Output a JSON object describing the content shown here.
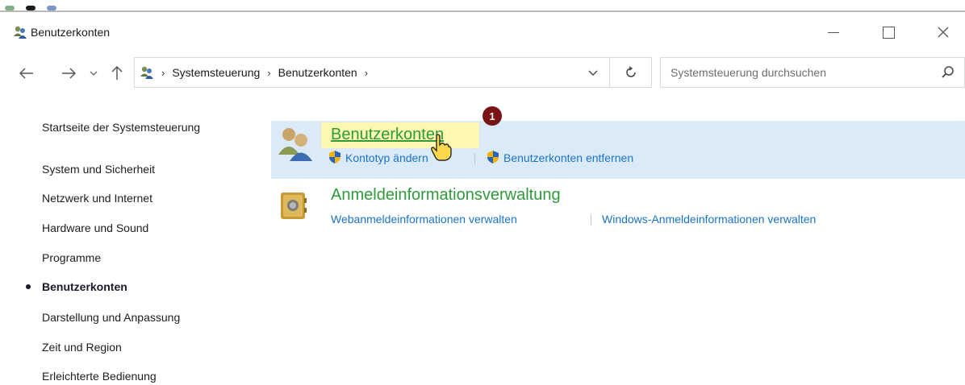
{
  "window": {
    "title": "Benutzerkonten"
  },
  "address": {
    "crumbs": [
      "Systemsteuerung",
      "Benutzerkonten"
    ]
  },
  "search": {
    "placeholder": "Systemsteuerung durchsuchen"
  },
  "sidebar": {
    "home": "Startseite der Systemsteuerung",
    "items": [
      {
        "label": "System und Sicherheit"
      },
      {
        "label": "Netzwerk und Internet"
      },
      {
        "label": "Hardware und Sound"
      },
      {
        "label": "Programme"
      },
      {
        "label": "Benutzerkonten"
      },
      {
        "label": "Darstellung und Anpassung"
      },
      {
        "label": "Zeit und Region"
      },
      {
        "label": "Erleichterte Bedienung"
      }
    ],
    "active_item": "Benutzerkonten"
  },
  "categories": [
    {
      "title": "Benutzerkonten",
      "links": [
        "Kontotyp ändern",
        "Benutzerkonten entfernen"
      ]
    },
    {
      "title": "Anmeldeinformationsverwaltung",
      "links": [
        "Webanmeldeinformationen verwalten",
        "Windows-Anmeldeinformationen verwalten"
      ]
    }
  ],
  "annotation": {
    "step": "1"
  },
  "colors": {
    "category_title": "#2e9a3a",
    "link": "#1a73c9",
    "highlight": "#dbeaf7",
    "marker": "#fff9a8",
    "badge": "#7a1414"
  }
}
